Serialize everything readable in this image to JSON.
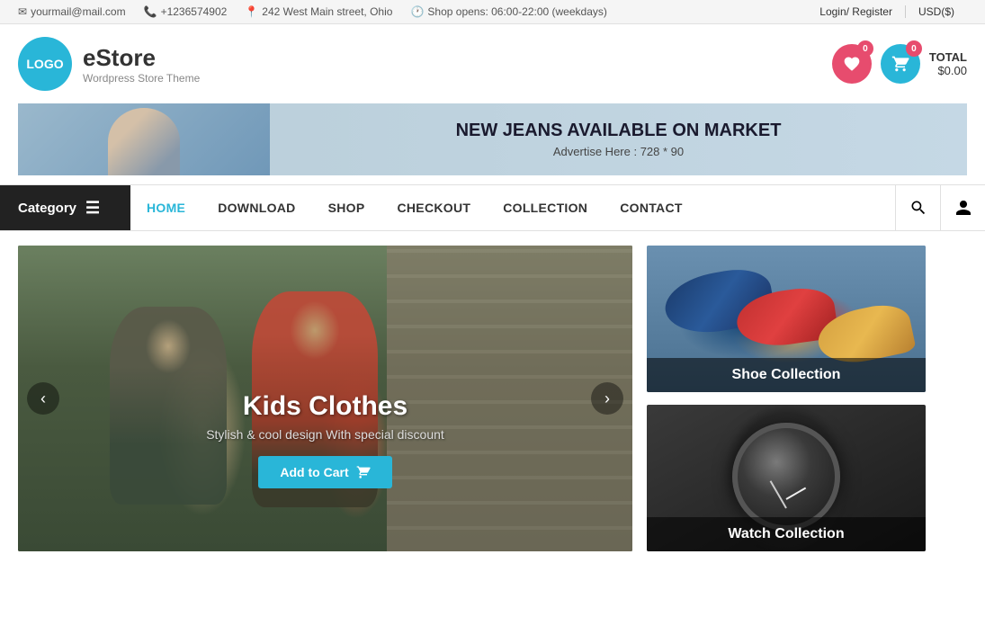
{
  "topbar": {
    "email_icon": "✉",
    "email": "yourmail@mail.com",
    "phone_icon": "📞",
    "phone": "+1236574902",
    "address_icon": "📍",
    "address": "242 West Main street, Ohio",
    "clock_icon": "🕐",
    "hours": "Shop opens: 06:00-22:00 (weekdays)",
    "login": "Login/ Register",
    "currency": "USD($)"
  },
  "header": {
    "logo_text": "LOGO",
    "site_name": "eStore",
    "tagline": "Wordpress Store Theme",
    "wishlist_count": "0",
    "cart_count": "0",
    "total_label": "TOTAL",
    "total_value": "$0.00"
  },
  "banner": {
    "headline": "NEW JEANS AVAILABLE ON MARKET",
    "subtext": "Advertise Here : 728 * 90"
  },
  "nav": {
    "category_label": "Category",
    "links": [
      {
        "label": "HOME",
        "active": true
      },
      {
        "label": "DOWNLOAD",
        "active": false
      },
      {
        "label": "SHOP",
        "active": false
      },
      {
        "label": "CHECKOUT",
        "active": false
      },
      {
        "label": "COLLECTION",
        "active": false
      },
      {
        "label": "CONTACT",
        "active": false
      }
    ]
  },
  "slider": {
    "title": "Kids Clothes",
    "subtitle": "Stylish & cool design With special discount",
    "cta": "Add to Cart"
  },
  "sidebar": {
    "card1_label": "Shoe Collection",
    "card2_label": "Watch Collection"
  }
}
